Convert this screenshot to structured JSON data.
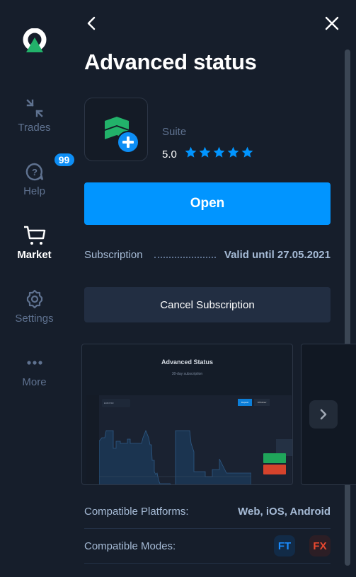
{
  "sidebar": {
    "items": [
      {
        "label": "Trades",
        "icon": "arrows-collapse-icon",
        "active": false
      },
      {
        "label": "Help",
        "icon": "help-bubble-icon",
        "active": false,
        "badge": "99"
      },
      {
        "label": "Market",
        "icon": "cart-icon",
        "active": true
      },
      {
        "label": "Settings",
        "icon": "gear-icon",
        "active": false
      },
      {
        "label": "More",
        "icon": "more-dots-icon",
        "active": false
      }
    ]
  },
  "header": {
    "back_icon": "chevron-left-icon",
    "close_icon": "close-icon",
    "title": "Advanced status"
  },
  "product": {
    "category": "Suite",
    "rating": "5.0",
    "stars": 5,
    "open_label": "Open",
    "subscription_label": "Subscription",
    "subscription_value": "Valid until 27.05.2021",
    "cancel_label": "Cancel Subscription"
  },
  "gallery": {
    "screenshots": [
      {
        "title": "Advanced Status",
        "subtitle": "30-day subscription",
        "deposit": "Deposit",
        "withdraw": "Withdraw",
        "pair": "EUR/USD"
      },
      {
        "title": "",
        "subtitle": ""
      }
    ],
    "next_icon": "chevron-right-icon"
  },
  "details": {
    "platforms_label": "Compatible Platforms:",
    "platforms_value": "Web, iOS, Android",
    "modes_label": "Compatible Modes:",
    "modes": [
      {
        "label": "FT",
        "color": "#1a8cff"
      },
      {
        "label": "FX",
        "color": "#e8482f"
      }
    ]
  },
  "colors": {
    "accent": "#0195ff",
    "background": "#161e2b",
    "muted_text": "#5f7290",
    "brand_green": "#22b26a"
  }
}
